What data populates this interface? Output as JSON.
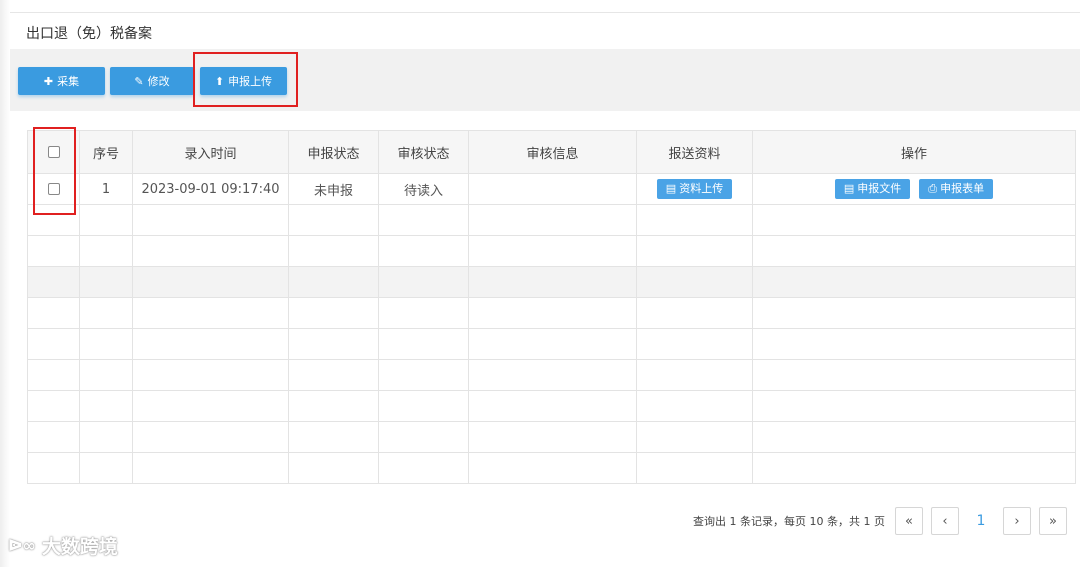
{
  "page": {
    "title": "出口退（免）税备案"
  },
  "toolbar": {
    "add_label": "采集",
    "edit_label": "修改",
    "upload_label": "申报上传"
  },
  "table": {
    "headers": [
      "序号",
      "录入时间",
      "申报状态",
      "审核状态",
      "审核信息",
      "报送资料",
      "操作"
    ],
    "rows": [
      {
        "index": "1",
        "time": "2023-09-01 09:17:40",
        "declare_status": "未申报",
        "review_status": "待读入",
        "review_info": "",
        "upload_material_label": "资料上传",
        "declare_file_label": "申报文件",
        "declare_form_label": "申报表单"
      }
    ]
  },
  "pager": {
    "summary": "查询出 1 条记录，每页 10 条，共 1 页",
    "first": "«",
    "prev": "‹",
    "current": "1",
    "next": "›",
    "last": "»"
  },
  "watermark": {
    "text": "大数跨境",
    "icon": "dashuju-logo-icon"
  },
  "colors": {
    "accent": "#3a9be0",
    "highlight": "#e02020"
  }
}
